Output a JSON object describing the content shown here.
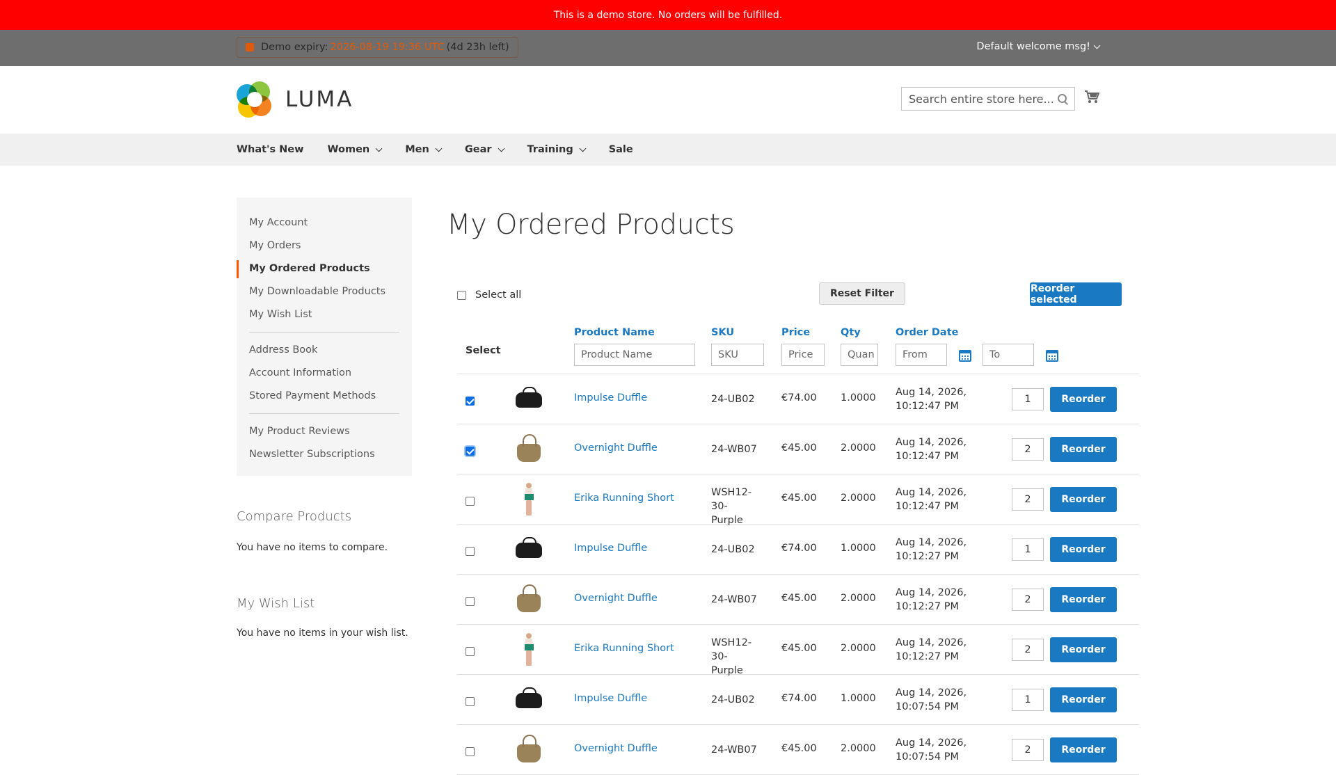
{
  "demo_notice": "This is a demo store. No orders will be fulfilled.",
  "panel": {
    "expiry_prefix": "Demo expiry:",
    "expiry_date": "2026-08-19 19:36 UTC",
    "expiry_left": "(4d 23h left)",
    "welcome": "Default welcome msg!"
  },
  "logo_text": "LUMA",
  "search": {
    "placeholder": "Search entire store here..."
  },
  "nav": [
    "What's New",
    "Women",
    "Men",
    "Gear",
    "Training",
    "Sale"
  ],
  "sidebar": {
    "group1": [
      "My Account",
      "My Orders",
      "My Ordered Products",
      "My Downloadable Products",
      "My Wish List"
    ],
    "group2": [
      "Address Book",
      "Account Information",
      "Stored Payment Methods"
    ],
    "group3": [
      "My Product Reviews",
      "Newsletter Subscriptions"
    ],
    "active": "My Ordered Products"
  },
  "compare": {
    "title": "Compare Products",
    "text": "You have no items to compare."
  },
  "wishlist": {
    "title": "My Wish List",
    "text": "You have no items in your wish list."
  },
  "page_title": "My Ordered Products",
  "toolbar": {
    "select_all": "Select all",
    "reset": "Reset Filter",
    "reorder_selected": "Reorder selected"
  },
  "grid": {
    "select_label": "Select",
    "headers": {
      "name": "Product Name",
      "sku": "SKU",
      "price": "Price",
      "qty": "Qty",
      "date": "Order Date"
    },
    "filters": {
      "name": "Product Name",
      "sku": "SKU",
      "price": "Price",
      "qty": "Quan",
      "from": "From",
      "to": "To"
    },
    "reorder_label": "Reorder",
    "rows": [
      {
        "checked": true,
        "thumb": "black-duffle",
        "name": "Impulse Duffle",
        "sku": "24-UB02",
        "price": "€74.00",
        "qty": "1.0000",
        "date1": "Aug 14, 2026,",
        "date2": "10:12:47 PM",
        "reorder_qty": "1"
      },
      {
        "checked": true,
        "thumb": "tan-duffle",
        "name": "Overnight Duffle",
        "sku": "24-WB07",
        "price": "€45.00",
        "qty": "2.0000",
        "date1": "Aug 14, 2026,",
        "date2": "10:12:47 PM",
        "reorder_qty": "2"
      },
      {
        "checked": false,
        "thumb": "running-short",
        "name": "Erika Running Short",
        "sku": "WSH12-30-Purple",
        "sku1": "WSH12-30-",
        "sku2": "Purple",
        "price": "€45.00",
        "qty": "2.0000",
        "date1": "Aug 14, 2026,",
        "date2": "10:12:47 PM",
        "reorder_qty": "2"
      },
      {
        "checked": false,
        "thumb": "black-duffle",
        "name": "Impulse Duffle",
        "sku": "24-UB02",
        "price": "€74.00",
        "qty": "1.0000",
        "date1": "Aug 14, 2026,",
        "date2": "10:12:27 PM",
        "reorder_qty": "1"
      },
      {
        "checked": false,
        "thumb": "tan-duffle",
        "name": "Overnight Duffle",
        "sku": "24-WB07",
        "price": "€45.00",
        "qty": "2.0000",
        "date1": "Aug 14, 2026,",
        "date2": "10:12:27 PM",
        "reorder_qty": "2"
      },
      {
        "checked": false,
        "thumb": "running-short",
        "name": "Erika Running Short",
        "sku": "WSH12-30-Purple",
        "sku1": "WSH12-30-",
        "sku2": "Purple",
        "price": "€45.00",
        "qty": "2.0000",
        "date1": "Aug 14, 2026,",
        "date2": "10:12:27 PM",
        "reorder_qty": "2"
      },
      {
        "checked": false,
        "thumb": "black-duffle",
        "name": "Impulse Duffle",
        "sku": "24-UB02",
        "price": "€74.00",
        "qty": "1.0000",
        "date1": "Aug 14, 2026,",
        "date2": "10:07:54 PM",
        "reorder_qty": "1"
      },
      {
        "checked": false,
        "thumb": "tan-duffle",
        "name": "Overnight Duffle",
        "sku": "24-WB07",
        "price": "€45.00",
        "qty": "2.0000",
        "date1": "Aug 14, 2026,",
        "date2": "10:07:54 PM",
        "reorder_qty": "2"
      }
    ]
  },
  "colors": {
    "demo_bar": "#ff0000",
    "accent": "#1979c3",
    "active_marker": "#ff5501",
    "expiry": "#e05a0c"
  }
}
